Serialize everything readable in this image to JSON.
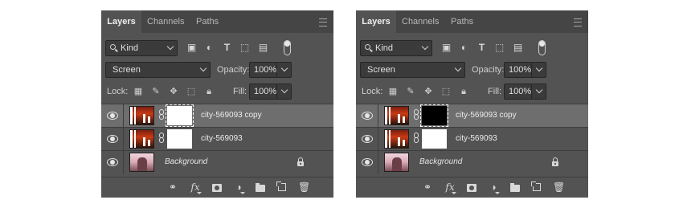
{
  "panels": [
    {
      "tabs": [
        "Layers",
        "Channels",
        "Paths"
      ],
      "filter": {
        "kind": "Kind",
        "icons": [
          "image-filter-icon",
          "adjustment-filter-icon",
          "type-filter-icon",
          "shape-filter-icon",
          "smart-object-filter-icon",
          "filter-toggle-icon"
        ]
      },
      "blend_mode": "Screen",
      "opacity_label": "Opacity:",
      "opacity_value": "100%",
      "lock_label": "Lock:",
      "fill_label": "Fill:",
      "fill_value": "100%",
      "layers": [
        {
          "name": "city-569093 copy",
          "mask": "white",
          "selected": true
        },
        {
          "name": "city-569093",
          "mask": "white",
          "selected": false
        },
        {
          "name": "Background",
          "locked": true
        }
      ],
      "footer_icons": [
        "link-icon",
        "fx-icon",
        "add-mask-icon",
        "adjustment-icon",
        "folder-icon",
        "new-layer-icon",
        "trash-icon"
      ]
    },
    {
      "tabs": [
        "Layers",
        "Channels",
        "Paths"
      ],
      "filter": {
        "kind": "Kind"
      },
      "blend_mode": "Screen",
      "opacity_label": "Opacity:",
      "opacity_value": "100%",
      "lock_label": "Lock:",
      "fill_label": "Fill:",
      "fill_value": "100%",
      "layers": [
        {
          "name": "city-569093 copy",
          "mask": "black",
          "selected": true
        },
        {
          "name": "city-569093",
          "mask": "white",
          "selected": false
        },
        {
          "name": "Background",
          "locked": true
        }
      ]
    }
  ],
  "colors": {
    "panel_bg": "#535353",
    "tabbar_bg": "#454545",
    "selected_row": "#6e6e6e",
    "control_bg": "#3b3b3b"
  }
}
